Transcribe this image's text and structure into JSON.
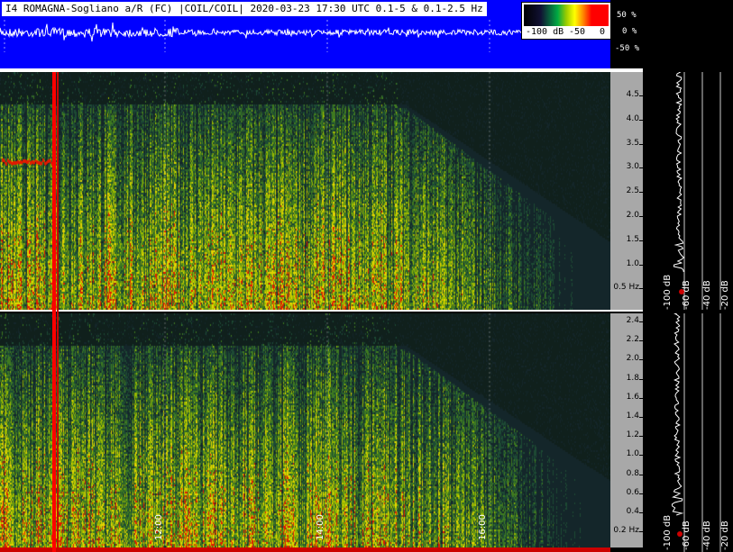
{
  "header": {
    "title": "I4 ROMAGNA-Sogliano a/R (FC) |COIL/COIL| 2020-03-23 17:30 UTC 0.1-5 & 0.1-2.5  Hz"
  },
  "colorbar": {
    "label_low": "-100 dB",
    "label_mid": "-50",
    "label_zero": "0"
  },
  "amplitude_axis": [
    "50 %",
    "0 %",
    "-50 %"
  ],
  "spectrogram_top": {
    "freq_ticks": [
      "4.5",
      "4.0",
      "3.5",
      "3.0",
      "2.5",
      "2.0",
      "1.5",
      "1.0",
      "0.5 Hz"
    ]
  },
  "spectrogram_bottom": {
    "freq_ticks": [
      "2.4",
      "2.2",
      "2.0",
      "1.8",
      "1.6",
      "1.4",
      "1.2",
      "1.0",
      "0.8",
      "0.6",
      "0.4",
      "0.2 Hz"
    ]
  },
  "time_axis": [
    "12:00",
    "14:00",
    "16:00"
  ],
  "profile_axis": {
    "db_labels": [
      "-100 dB",
      "-60 dB",
      "-40 dB",
      "-20 dB"
    ]
  },
  "colors": {
    "header_bg": "#0000ff",
    "axis_bg": "#a8a8a8",
    "marker_red": "#ff0000"
  }
}
